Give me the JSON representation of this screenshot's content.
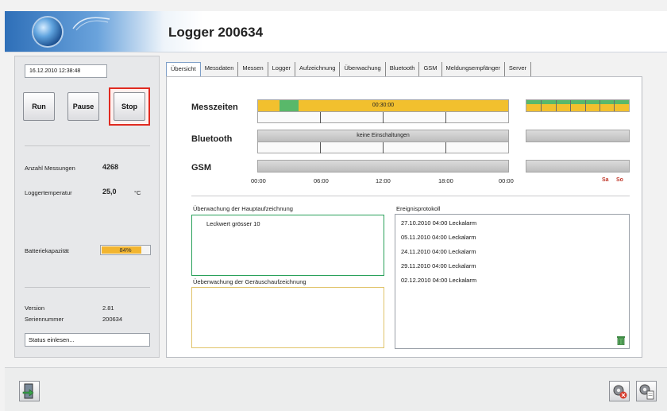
{
  "window": {
    "title": "Logger 200634"
  },
  "left_panel": {
    "datetime": "16.12.2010 12:38:48",
    "buttons": {
      "run": "Run",
      "pause": "Pause",
      "stop": "Stop"
    },
    "measurements_label": "Anzahl Messungen",
    "measurements_value": "4268",
    "temperature_label": "Loggertemperatur",
    "temperature_value": "25,0",
    "temperature_unit": "°C",
    "battery_label": "Batteriekapazität",
    "battery_value": "84%",
    "battery_fraction": 0.84,
    "version_label": "Version",
    "version_value": "2.81",
    "serial_label": "Seriennummer",
    "serial_value": "200634",
    "status_button": "Status einlesen..."
  },
  "tabs": [
    "Übersicht",
    "Messdaten",
    "Messen",
    "Logger",
    "Aufzeichnung",
    "Überwachung",
    "Bluetooth",
    "GSM",
    "Meldungsempfänger",
    "Server"
  ],
  "active_tab": "Übersicht",
  "schedule": {
    "rows": {
      "messzeiten": "Messzeiten",
      "bluetooth": "Bluetooth",
      "gsm": "GSM"
    },
    "messzeiten_bar_text": "00:30:00",
    "bluetooth_bar_text": "keine Einschaltungen",
    "time_axis": [
      "00:00",
      "06:00",
      "12:00",
      "18:00",
      "00:00"
    ],
    "weekend": {
      "sa": "Sa",
      "so": "So"
    },
    "colors": {
      "measure": "#f2c02e",
      "measure_active": "#59b86a",
      "off": "#c9c9c9"
    }
  },
  "monitoring": {
    "main_label": "Überwachung der Hauptaufzeichnung",
    "main_item": "Leckwert grösser 10",
    "noise_label": "Üeberwachung der Geräuschaufzeichnung"
  },
  "events": {
    "label": "Ereignisprotokoll",
    "items": [
      "27.10.2010 04:00 Leckalarm",
      "05.11.2010 04:00 Leckalarm",
      "24.11.2010 04:00 Leckalarm",
      "29.11.2010 04:00 Leckalarm",
      "02.12.2010 04:00 Leckalarm"
    ]
  }
}
